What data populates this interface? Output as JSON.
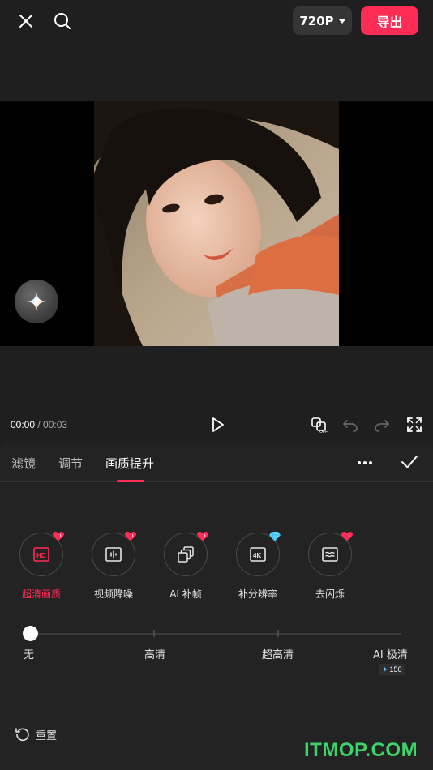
{
  "header": {
    "resolution": "720P",
    "export_label": "导出"
  },
  "playback": {
    "current_time": "00:00",
    "separator": " / ",
    "total_time": "00:03"
  },
  "tabs": [
    {
      "label": "滤镜",
      "active": false
    },
    {
      "label": "调节",
      "active": false
    },
    {
      "label": "画质提升",
      "active": true
    }
  ],
  "tools": [
    {
      "label": "超清画质",
      "icon": "hd-icon",
      "active": true,
      "badge": "pro-heart"
    },
    {
      "label": "视频降噪",
      "icon": "denoise-icon",
      "active": false,
      "badge": "pro-heart"
    },
    {
      "label": "AI 补帧",
      "icon": "frame-interp-icon",
      "active": false,
      "badge": "pro-heart"
    },
    {
      "label": "补分辨率",
      "icon": "4k-icon",
      "active": false,
      "badge": "diamond"
    },
    {
      "label": "去闪烁",
      "icon": "deflicker-icon",
      "active": false,
      "badge": "pro-heart"
    }
  ],
  "slider": {
    "labels": [
      "无",
      "高清",
      "超高清",
      "AI 极清"
    ],
    "selected_index": 0,
    "credit": "150"
  },
  "reset_label": "重置",
  "watermark": "ITMOP.COM",
  "colors": {
    "accent": "#fe2c55",
    "background": "#202020",
    "panel": "#232323",
    "watermark": "#3dd36a"
  }
}
